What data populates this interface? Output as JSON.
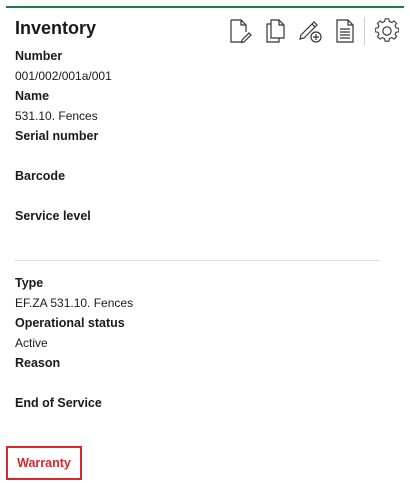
{
  "panel": {
    "title": "Inventory",
    "accent_color": "#1f7a4a",
    "toolbar": [
      {
        "icon": "edit-document-icon",
        "label": ""
      },
      {
        "icon": "copy-document-icon",
        "label": ""
      },
      {
        "icon": "add-pencil-icon",
        "label": ""
      },
      {
        "icon": "document-list-icon",
        "label": ""
      },
      {
        "icon": "gear-icon",
        "label": ""
      }
    ]
  },
  "fields": {
    "number_label": "Number",
    "number_value": "001/002/001a/001",
    "name_label": "Name",
    "name_value": "531.10. Fences",
    "serial_label": "Serial number",
    "serial_value": "",
    "barcode_label": "Barcode",
    "barcode_value": "",
    "service_level_label": "Service level",
    "service_level_value": "",
    "type_label": "Type",
    "type_value": "EF.ZA 531.10. Fences",
    "operational_status_label": "Operational status",
    "operational_status_value": "Active",
    "reason_label": "Reason",
    "reason_value": "",
    "end_of_service_label": "End of Service",
    "end_of_service_value": ""
  },
  "warranty": {
    "label": "Warranty",
    "color": "#d9262c"
  }
}
